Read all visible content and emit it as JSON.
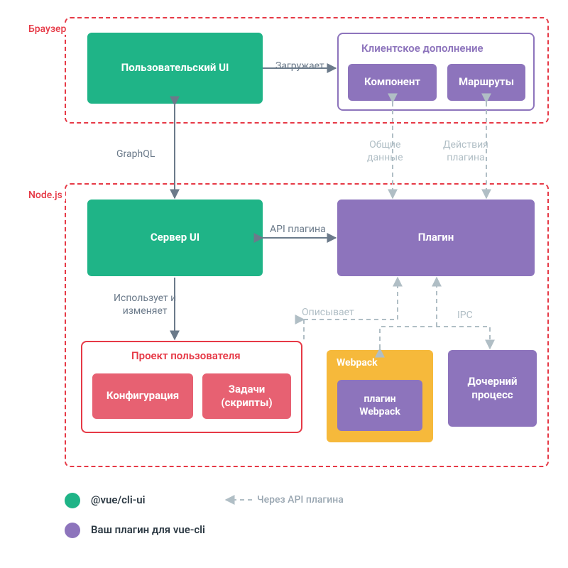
{
  "sections": {
    "browser": "Браузер",
    "node": "Node.js"
  },
  "boxes": {
    "userUi": "Пользовательский UI",
    "clientExtension": "Клиентское дополнение",
    "component": "Компонент",
    "routes": "Маршруты",
    "serverUi": "Сервер UI",
    "plugin": "Плагин",
    "userProject": "Проект пользователя",
    "configuration": "Конфигурация",
    "tasks": "Задачи\n(скрипты)",
    "webpack": "Webpack",
    "webpackPlugin": "плагин\nWebpack",
    "childProcess": "Дочерний\nпроцесс"
  },
  "edges": {
    "loads": "Загружает",
    "graphql": "GraphQL",
    "sharedData": "Общие\nданные",
    "pluginActions": "Действия\nплагина",
    "apiPlugin": "API плагина",
    "usesAndChanges": "Использует и\nизменяет",
    "describes": "Описывает",
    "ipc": "IPC"
  },
  "legend": {
    "cliUi": "@vue/cli-ui",
    "yourPlugin": "Ваш плагин для vue-cli",
    "viaApi": "Через API плагина"
  }
}
